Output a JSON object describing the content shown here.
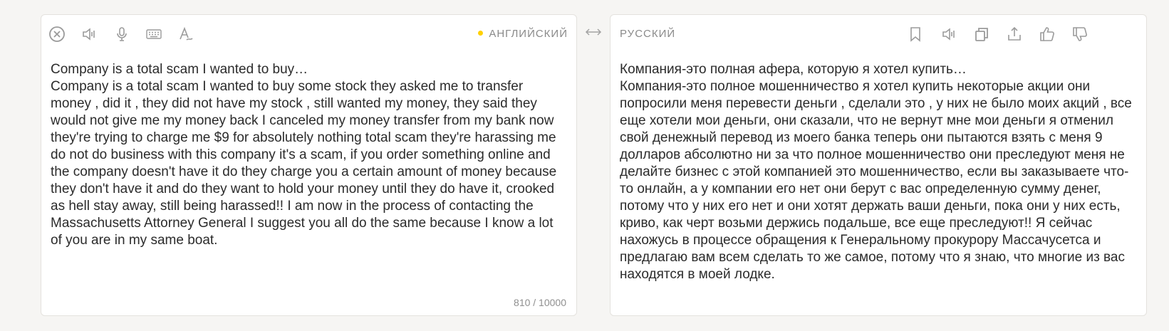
{
  "source": {
    "language": "АНГЛИЙСКИЙ",
    "text": "Company is a total scam I wanted to buy…\nCompany is a total scam I wanted to buy some stock they asked me to transfer money , did it , they did not have my stock , still wanted my money, they said they would not give me my money back I canceled my money transfer from my bank now they're trying to charge me $9 for absolutely nothing total scam they're harassing me do not do business with this company it's a scam, if you order something online and the company doesn't have it do they charge you a certain amount of money because they don't have it and do they want to hold your money until they do have it, crooked as hell stay away, still being harassed!! I am now in the process of contacting the Massachusetts Attorney General I suggest you all do the same because I know a lot of you are in my same boat.",
    "counter": "810 / 10000",
    "icons": [
      "clear-icon",
      "speaker-icon",
      "microphone-icon",
      "keyboard-icon",
      "handwriting-icon"
    ]
  },
  "swap_icon": "swap-arrows-icon",
  "target": {
    "language": "РУССКИЙ",
    "text": "Компания-это полная афера, которую я хотел купить…\nКомпания-это полное мошенничество я хотел купить некоторые акции они попросили меня перевести деньги , сделали это , у них не было моих акций , все еще хотели мои деньги, они сказали, что не вернут мне мои деньги я отменил свой денежный перевод из моего банка теперь они пытаются взять с меня 9 долларов абсолютно ни за что полное мошенничество они преследуют меня не делайте бизнес с этой компанией это мошенничество, если вы заказываете что-то онлайн, а у компании его нет они берут с вас определенную сумму денег, потому что у них его нет и они хотят держать ваши деньги, пока они у них есть, криво, как черт возьми держись подальше, все еще преследуют!! Я сейчас нахожусь в процессе обращения к Генеральному прокурору Массачусетса и предлагаю вам всем сделать то же самое, потому что я знаю, что многие из вас находятся в моей лодке.",
    "icons": [
      "bookmark-icon",
      "speaker-icon",
      "copy-icon",
      "share-icon",
      "thumbs-up-icon",
      "thumbs-down-icon"
    ]
  },
  "colors": {
    "background": "#f6f5f3",
    "panel": "#ffffff",
    "accent_dot": "#ffd000",
    "icon": "#9b9b9b"
  }
}
